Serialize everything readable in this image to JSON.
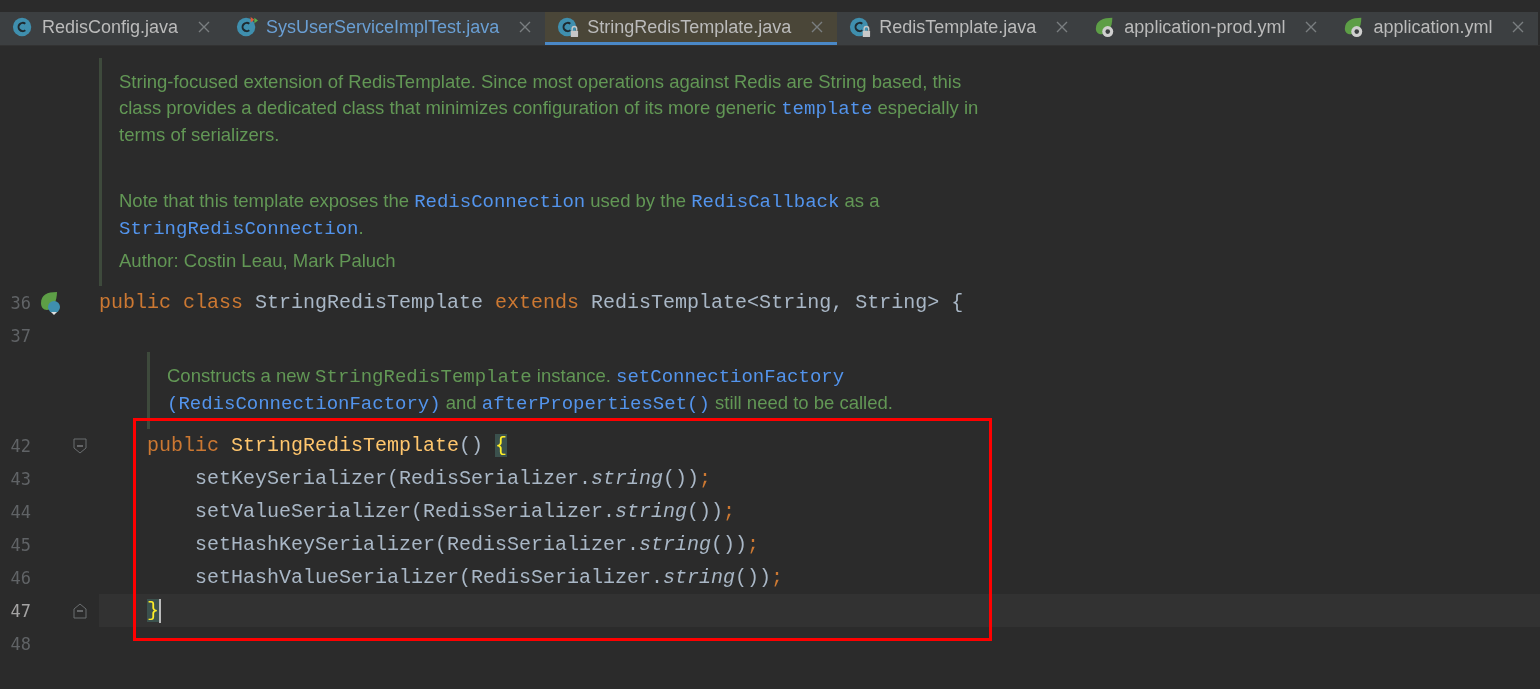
{
  "tabs": [
    {
      "label": "RedisConfig.java",
      "kind": "java",
      "locked": false,
      "selected": false
    },
    {
      "label": "SysUserServiceImplTest.java",
      "kind": "java-test",
      "locked": false,
      "selected": false
    },
    {
      "label": "StringRedisTemplate.java",
      "kind": "java",
      "locked": true,
      "selected": true
    },
    {
      "label": "RedisTemplate.java",
      "kind": "java",
      "locked": true,
      "selected": false
    },
    {
      "label": "application-prod.yml",
      "kind": "yml",
      "selected": false
    },
    {
      "label": "application.yml",
      "kind": "yml",
      "selected": false
    }
  ],
  "editor": {
    "rows": [
      {
        "kind": "doc",
        "paragraphs": [
          [
            [
              {
                "kind": "plain",
                "text": "String-focused extension of RedisTemplate. Since most operations against Redis are String based, this"
              }
            ],
            [
              {
                "kind": "plain",
                "text": "class provides a dedicated class that minimizes configuration of its more generic "
              },
              {
                "kind": "link",
                "text": "template"
              },
              {
                "kind": "plain",
                "text": " especially in"
              }
            ],
            [
              {
                "kind": "plain",
                "text": "terms of serializers."
              }
            ]
          ],
          [
            [
              {
                "kind": "plain",
                "text": "Note that this template exposes the "
              },
              {
                "kind": "link",
                "text": "RedisConnection"
              },
              {
                "kind": "plain",
                "text": " used by the "
              },
              {
                "kind": "link",
                "text": "RedisCallback"
              },
              {
                "kind": "plain",
                "text": " as a"
              }
            ],
            [
              {
                "kind": "link",
                "text": "StringRedisConnection"
              },
              {
                "kind": "plain",
                "text": "."
              }
            ]
          ]
        ],
        "author": "Author: Costin Leau, Mark Paluch"
      },
      {
        "kind": "code",
        "number": "36",
        "current": false,
        "gutter_marker": true,
        "tokens": [
          {
            "kind": "keyword",
            "text": "public "
          },
          {
            "kind": "keyword",
            "text": "class"
          },
          {
            "kind": "plain",
            "text": " StringRedisTemplate "
          },
          {
            "kind": "keyword",
            "text": "extends"
          },
          {
            "kind": "plain",
            "text": " RedisTemplate<String, String> {"
          }
        ],
        "children": [
          {
            "kind": "code",
            "number": "37",
            "current": false
          },
          {
            "kind": "doc",
            "paragraphs": [
              [
                [
                  {
                    "kind": "plain",
                    "text": "Constructs a new "
                  },
                  {
                    "kind": "code",
                    "text": "StringRedisTemplate"
                  },
                  {
                    "kind": "plain",
                    "text": " instance. "
                  },
                  {
                    "kind": "link",
                    "text": "setConnectionFactory"
                  }
                ],
                [
                  {
                    "kind": "link",
                    "text": "(RedisConnectionFactory)"
                  },
                  {
                    "kind": "plain",
                    "text": " and "
                  },
                  {
                    "kind": "link",
                    "text": "afterPropertiesSet()"
                  },
                  {
                    "kind": "plain",
                    "text": " still need to be called."
                  }
                ]
              ]
            ]
          },
          {
            "kind": "code",
            "number": "42",
            "current": false,
            "fold_open": true,
            "boxed": true,
            "tokens": [
              {
                "kind": "keyword",
                "text": "public "
              },
              {
                "kind": "declaration",
                "text": "StringRedisTemplate"
              },
              {
                "kind": "plain",
                "text": "() "
              },
              {
                "kind": "brace-match",
                "text": "{"
              }
            ],
            "children": [
              {
                "kind": "code",
                "number": "43",
                "current": false,
                "boxed": true,
                "tokens": [
                  {
                    "kind": "plain",
                    "text": "setKeySerializer(RedisSerializer."
                  },
                  {
                    "kind": "static-call",
                    "text": "string"
                  },
                  {
                    "kind": "plain",
                    "text": "())"
                  },
                  {
                    "kind": "semicolon",
                    "text": ";"
                  }
                ]
              },
              {
                "kind": "code",
                "number": "44",
                "current": false,
                "boxed": true,
                "tokens": [
                  {
                    "kind": "plain",
                    "text": "setValueSerializer(RedisSerializer."
                  },
                  {
                    "kind": "static-call",
                    "text": "string"
                  },
                  {
                    "kind": "plain",
                    "text": "())"
                  },
                  {
                    "kind": "semicolon",
                    "text": ";"
                  }
                ]
              },
              {
                "kind": "code",
                "number": "45",
                "current": false,
                "boxed": true,
                "tokens": [
                  {
                    "kind": "plain",
                    "text": "setHashKeySerializer(RedisSerializer."
                  },
                  {
                    "kind": "static-call",
                    "text": "string"
                  },
                  {
                    "kind": "plain",
                    "text": "())"
                  },
                  {
                    "kind": "semicolon",
                    "text": ";"
                  }
                ]
              },
              {
                "kind": "code",
                "number": "46",
                "current": false,
                "boxed": true,
                "tokens": [
                  {
                    "kind": "plain",
                    "text": "setHashValueSerializer(RedisSerializer."
                  },
                  {
                    "kind": "static-call",
                    "text": "string"
                  },
                  {
                    "kind": "plain",
                    "text": "())"
                  },
                  {
                    "kind": "semicolon",
                    "text": ";"
                  }
                ]
              }
            ]
          },
          {
            "kind": "code",
            "number": "47",
            "current": true,
            "fold_close": true,
            "boxed": true,
            "tokens": [
              {
                "kind": "brace-match",
                "text": "}"
              }
            ]
          },
          {
            "kind": "code",
            "number": "48",
            "current": false
          }
        ]
      }
    ]
  }
}
